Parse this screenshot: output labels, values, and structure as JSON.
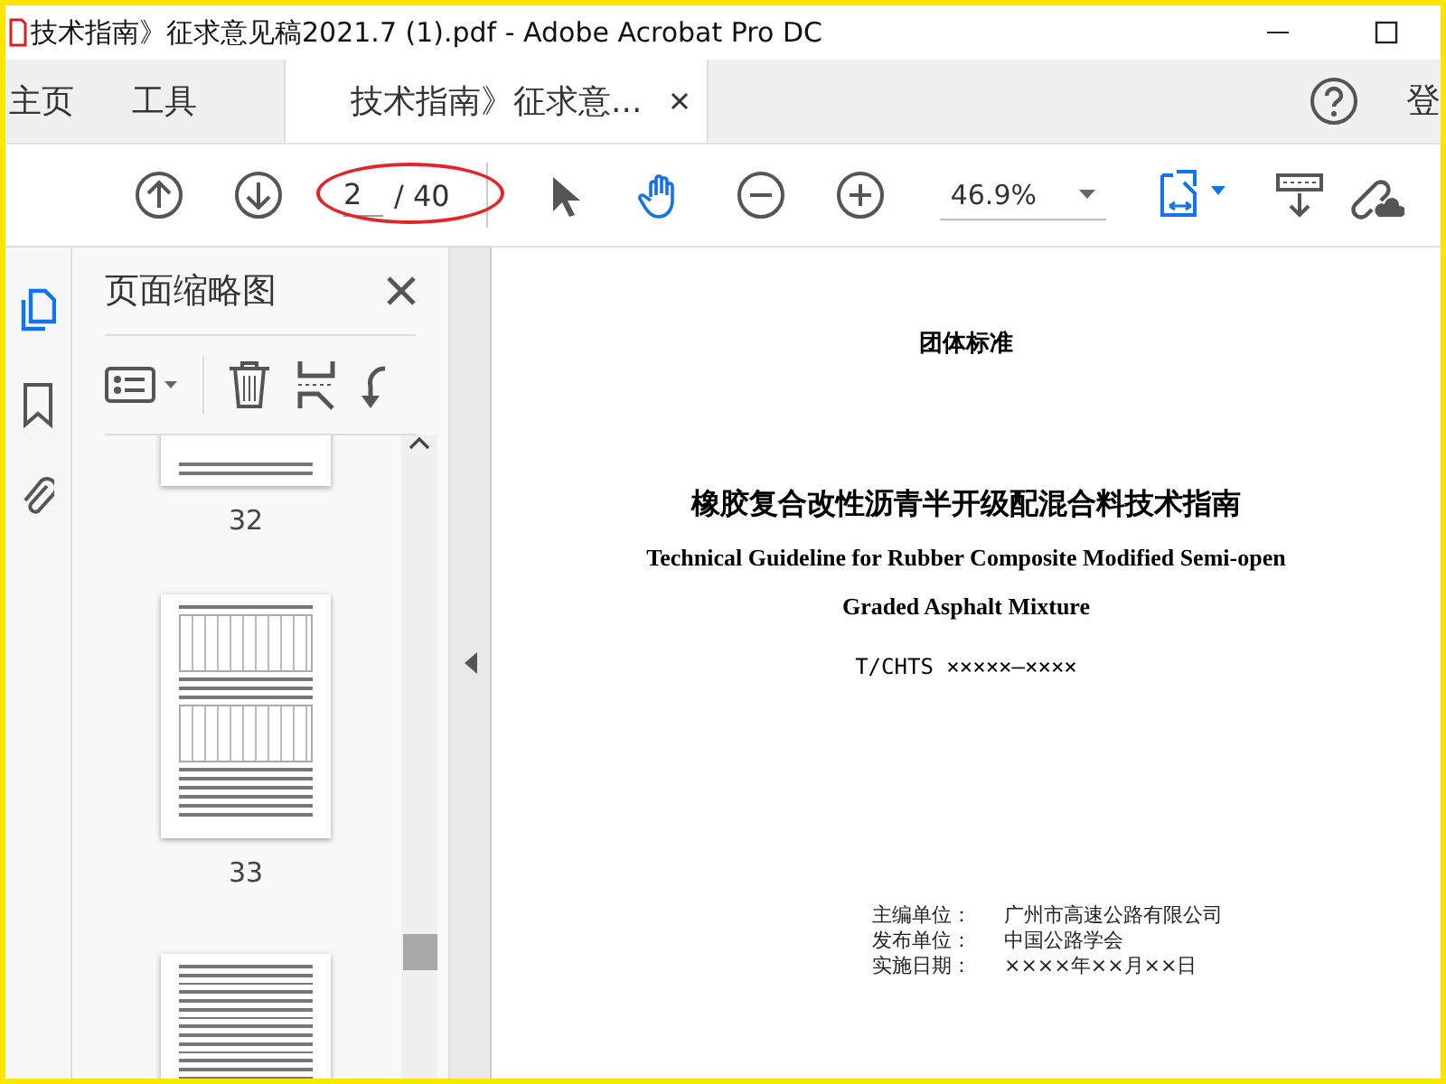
{
  "window": {
    "title": "技术指南》征求意见稿2021.7 (1).pdf - Adobe Acrobat Pro DC"
  },
  "nav_tabs": [
    {
      "label": "主页",
      "selected": false
    },
    {
      "label": "工具",
      "selected": false
    },
    {
      "label": "技术指南》征求意...",
      "selected": true
    }
  ],
  "account_label": "登",
  "toolbar": {
    "page_value": "2",
    "page_total": "/ 40",
    "zoom": "46.9%"
  },
  "thumbnails_panel": {
    "title": "页面缩略图",
    "thumbnails": [
      {
        "kind": "top-cut",
        "label": "32"
      },
      {
        "kind": "table",
        "label": "33"
      },
      {
        "kind": "bottom-cut"
      }
    ]
  },
  "document": {
    "header": "团体标准",
    "title": "橡胶复合改性沥青半开级配混合料技术指南",
    "english_title": [
      "Technical Guideline for Rubber Composite Modified Semi-open",
      "Graded Asphalt Mixture"
    ],
    "code": "T/CHTS ×××××—××××",
    "info": [
      {
        "label": "主编单位：",
        "value": "广州市高速公路有限公司"
      },
      {
        "label": "发布单位：",
        "value": "中国公路学会"
      },
      {
        "label": "实施日期：",
        "value": "××××年××月××日"
      }
    ]
  }
}
